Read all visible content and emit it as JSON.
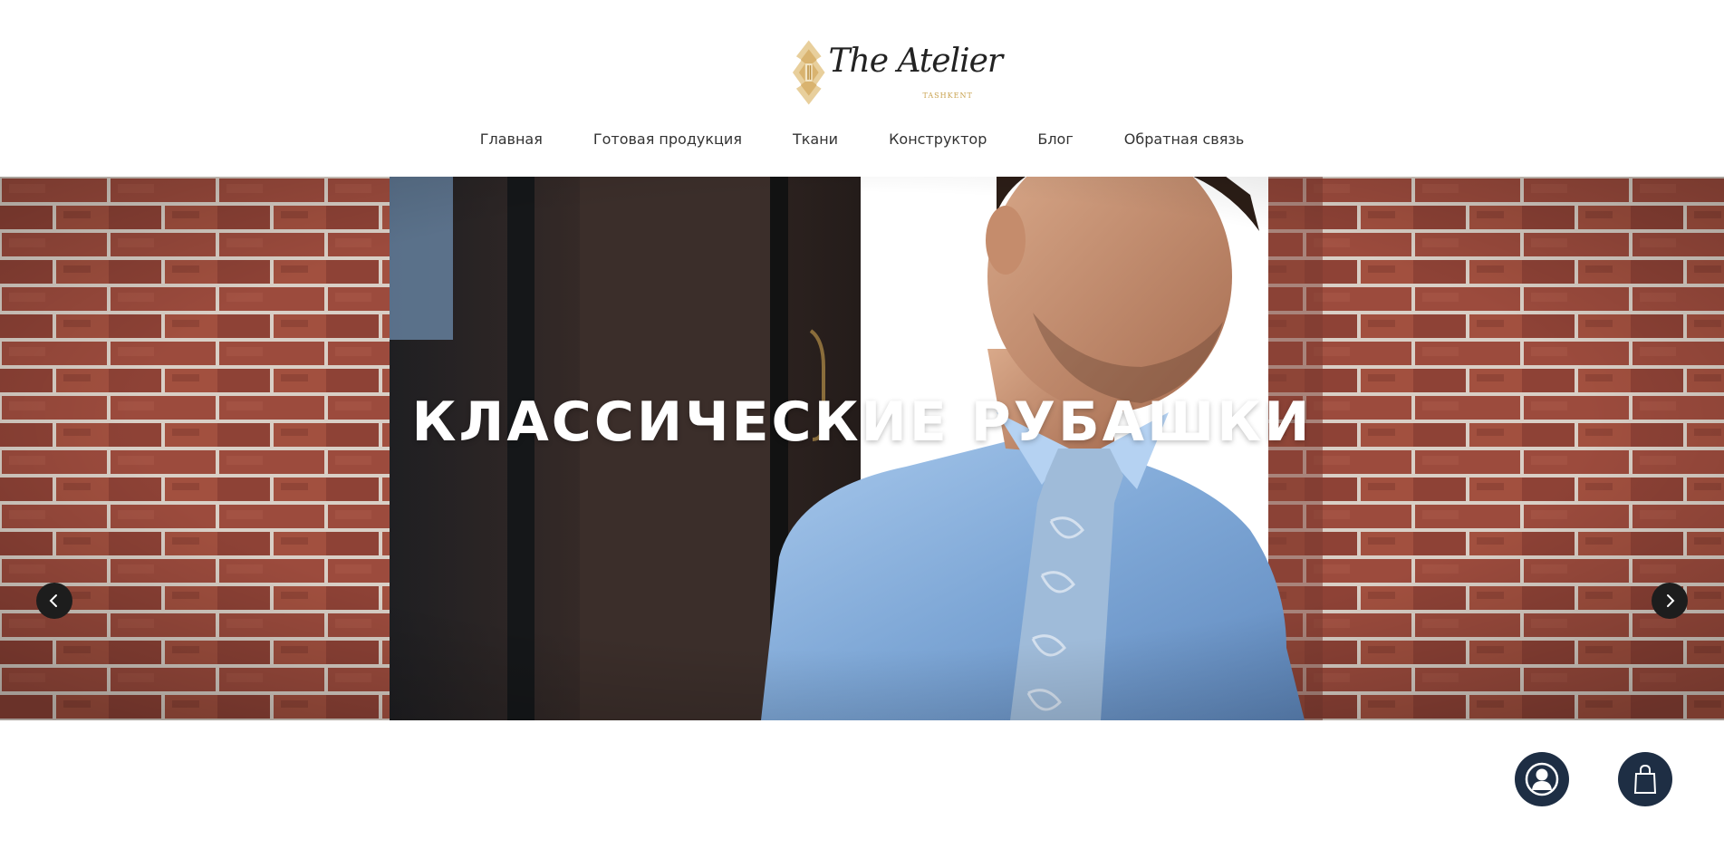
{
  "brand": {
    "name": "The Atelier",
    "sub": "TASHKENT",
    "accent_color": "#c8a24e"
  },
  "nav": {
    "items": [
      {
        "label": "Главная"
      },
      {
        "label": "Готовая продукция"
      },
      {
        "label": "Ткани"
      },
      {
        "label": "Конструктор"
      },
      {
        "label": "Блог"
      },
      {
        "label": "Обратная связь"
      }
    ]
  },
  "hero": {
    "title": "КЛАССИЧЕСКИЕ РУБАШКИ",
    "prev_icon": "chevron-left-icon",
    "next_icon": "chevron-right-icon"
  },
  "floating": {
    "account_icon": "user-icon",
    "cart_icon": "shopping-bag-icon",
    "color": "#1e2e44"
  }
}
